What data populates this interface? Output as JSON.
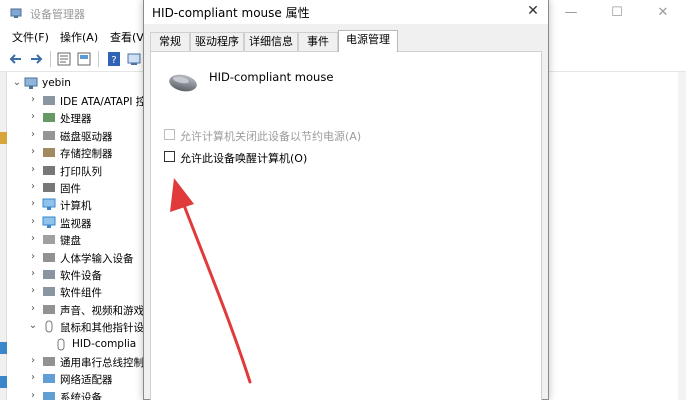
{
  "background_window": {
    "title": "设备管理器",
    "menu": [
      "文件(F)",
      "操作(A)",
      "查看(V)"
    ],
    "tree": {
      "root": "yebin",
      "items": [
        {
          "label": "IDE ATA/ATAPI 控",
          "icon": "ide-controller-icon",
          "expanded": false
        },
        {
          "label": "处理器",
          "icon": "processor-icon",
          "expanded": false
        },
        {
          "label": "磁盘驱动器",
          "icon": "disk-drive-icon",
          "expanded": false
        },
        {
          "label": "存储控制器",
          "icon": "storage-controller-icon",
          "expanded": false
        },
        {
          "label": "打印队列",
          "icon": "print-queue-icon",
          "expanded": false
        },
        {
          "label": "固件",
          "icon": "firmware-icon",
          "expanded": false
        },
        {
          "label": "计算机",
          "icon": "computer-icon",
          "expanded": false
        },
        {
          "label": "监视器",
          "icon": "monitor-icon",
          "expanded": false
        },
        {
          "label": "键盘",
          "icon": "keyboard-icon",
          "expanded": false
        },
        {
          "label": "人体学输入设备",
          "icon": "hid-icon",
          "expanded": false
        },
        {
          "label": "软件设备",
          "icon": "software-device-icon",
          "expanded": false
        },
        {
          "label": "软件组件",
          "icon": "software-component-icon",
          "expanded": false
        },
        {
          "label": "声音、视频和游戏",
          "icon": "audio-icon",
          "expanded": false
        },
        {
          "label": "鼠标和其他指针设",
          "icon": "mouse-icon",
          "expanded": true
        },
        {
          "label": "HID-complia",
          "icon": "mouse-icon",
          "child": true
        },
        {
          "label": "通用串行总线控制",
          "icon": "usb-icon",
          "expanded": false
        },
        {
          "label": "网络适配器",
          "icon": "network-adapter-icon",
          "expanded": false
        },
        {
          "label": "系统设备",
          "icon": "system-device-icon",
          "expanded": false
        }
      ]
    }
  },
  "dialog": {
    "title": "HID-compliant mouse 属性",
    "close": "✕",
    "tabs": [
      "常规",
      "驱动程序",
      "详细信息",
      "事件",
      "电源管理"
    ],
    "active_tab": "电源管理",
    "device_name": "HID-compliant mouse",
    "options": [
      {
        "label": "允许计算机关闭此设备以节约电源(A)",
        "checked": false,
        "enabled": false
      },
      {
        "label": "允许此设备唤醒计算机(O)",
        "checked": false,
        "enabled": true
      }
    ]
  },
  "colors": {
    "annotation_arrow": "#e03a3a",
    "dialog_bg": "#f0f0f0",
    "panel_bg": "#ffffff"
  }
}
